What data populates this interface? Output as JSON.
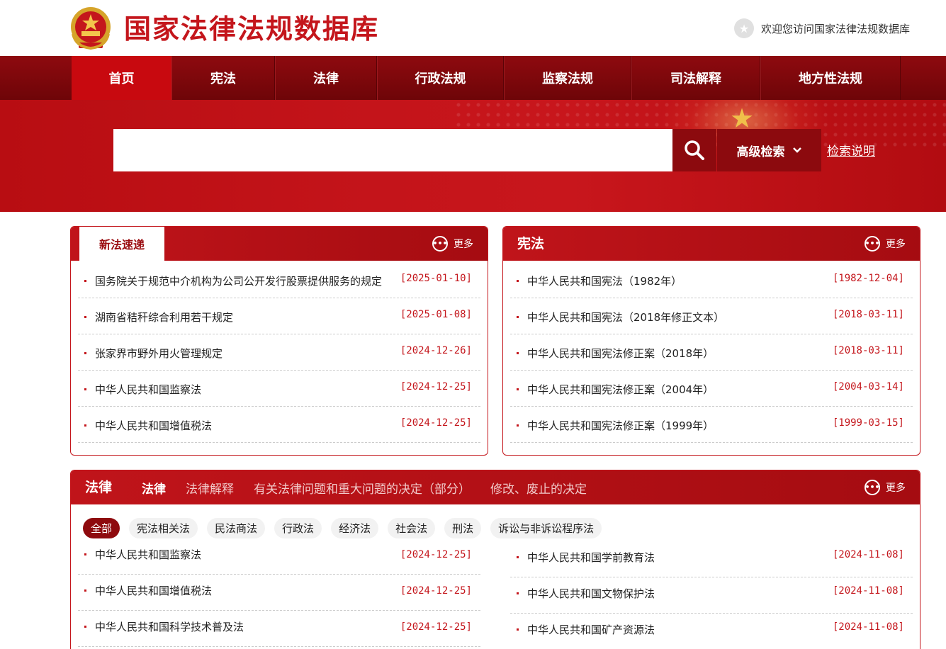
{
  "header": {
    "site_title": "国家法律法规数据库",
    "welcome_text": "欢迎您访问国家法律法规数据库"
  },
  "nav": {
    "items": [
      {
        "label": "首页",
        "active": true
      },
      {
        "label": "宪法",
        "active": false
      },
      {
        "label": "法律",
        "active": false
      },
      {
        "label": "行政法规",
        "active": false
      },
      {
        "label": "监察法规",
        "active": false
      },
      {
        "label": "司法解释",
        "active": false
      },
      {
        "label": "地方性法规",
        "active": false
      }
    ]
  },
  "search": {
    "value": "",
    "placeholder": "",
    "advanced_label": "高级检索",
    "help_label": "检索说明"
  },
  "new_laws": {
    "tab_label": "新法速递",
    "more_label": "更多",
    "items": [
      {
        "title": "国务院关于规范中介机构为公司公开发行股票提供服务的规定",
        "date": "[2025-01-10]"
      },
      {
        "title": "湖南省秸秆综合利用若干规定",
        "date": "[2025-01-08]"
      },
      {
        "title": "张家界市野外用火管理规定",
        "date": "[2024-12-26]"
      },
      {
        "title": "中华人民共和国监察法",
        "date": "[2024-12-25]"
      },
      {
        "title": "中华人民共和国增值税法",
        "date": "[2024-12-25]"
      }
    ]
  },
  "constitution": {
    "title": "宪法",
    "more_label": "更多",
    "items": [
      {
        "title": "中华人民共和国宪法（1982年）",
        "date": "[1982-12-04]"
      },
      {
        "title": "中华人民共和国宪法（2018年修正文本）",
        "date": "[2018-03-11]"
      },
      {
        "title": "中华人民共和国宪法修正案（2018年）",
        "date": "[2018-03-11]"
      },
      {
        "title": "中华人民共和国宪法修正案（2004年）",
        "date": "[2004-03-14]"
      },
      {
        "title": "中华人民共和国宪法修正案（1999年）",
        "date": "[1999-03-15]"
      }
    ]
  },
  "laws": {
    "title": "法律",
    "more_label": "更多",
    "tabs": [
      {
        "label": "法律",
        "active": true
      },
      {
        "label": "法律解释",
        "active": false
      },
      {
        "label": "有关法律问题和重大问题的决定（部分）",
        "active": false
      },
      {
        "label": "修改、废止的决定",
        "active": false
      }
    ],
    "chips": [
      {
        "label": "全部",
        "active": true
      },
      {
        "label": "宪法相关法",
        "active": false
      },
      {
        "label": "民法商法",
        "active": false
      },
      {
        "label": "行政法",
        "active": false
      },
      {
        "label": "经济法",
        "active": false
      },
      {
        "label": "社会法",
        "active": false
      },
      {
        "label": "刑法",
        "active": false
      },
      {
        "label": "诉讼与非诉讼程序法",
        "active": false
      }
    ],
    "left_items": [
      {
        "title": "中华人民共和国监察法",
        "date": "[2024-12-25]"
      },
      {
        "title": "中华人民共和国增值税法",
        "date": "[2024-12-25]"
      },
      {
        "title": "中华人民共和国科学技术普及法",
        "date": "[2024-12-25]"
      }
    ],
    "right_items": [
      {
        "title": "中华人民共和国学前教育法",
        "date": "[2024-11-08]"
      },
      {
        "title": "中华人民共和国文物保护法",
        "date": "[2024-11-08]"
      },
      {
        "title": "中华人民共和国矿产资源法",
        "date": "[2024-11-08]"
      }
    ]
  },
  "icons": {
    "emblem": "national-emblem-icon",
    "welcome": "star-icon",
    "search": "search-icon",
    "dropdown": "chevron-down-icon",
    "more": "more-dots-icon"
  },
  "colors": {
    "brand_red": "#c4161c",
    "nav_dark": "#7a060a",
    "nav_active": "#c8090f",
    "date_red": "#c4161c"
  }
}
